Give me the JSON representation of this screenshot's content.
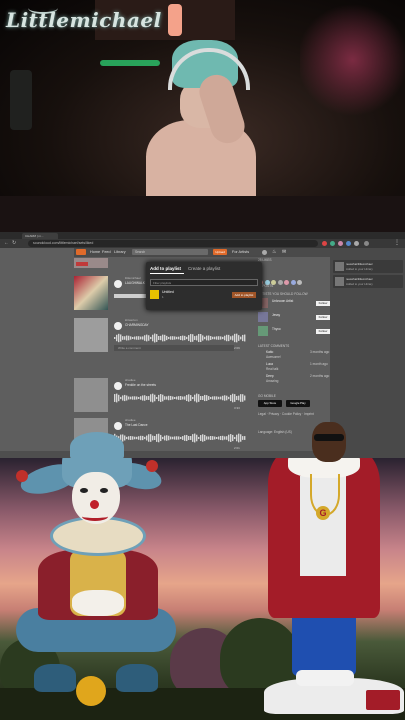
{
  "stream": {
    "logo_text": "Littlemichael"
  },
  "browser": {
    "tab_title": "CHARM | m...",
    "url": "soundcloud.com/littlemichael/sets/liked",
    "nav": {
      "home": "Home",
      "feed": "Feed",
      "library": "Library",
      "search_placeholder": "Search",
      "upload": "Upload",
      "for_artists": "For Artists"
    },
    "tracks": [
      {
        "user": "littlemichael",
        "title": "LAUGHWALK",
        "duration": "3:14"
      },
      {
        "user": "kirtaszion",
        "title": "CHARMINGDAY",
        "duration": "2:09"
      },
      {
        "user": "shadiee",
        "title": "Freddie on the streets",
        "duration": "3:33"
      },
      {
        "user": "shadiee",
        "title": "The Last Dance",
        "duration": "2:01"
      }
    ],
    "track_buttons": [
      "Like",
      "Repost",
      "Share",
      "Copy"
    ],
    "comment_placeholder": "Write a comment",
    "modal": {
      "tab_add": "Add to playlist",
      "tab_create": "Create a playlist",
      "filter_placeholder": "Filter playlists",
      "playlist_name": "Untitled",
      "playlist_count": "1",
      "add_button": "Add to playlist"
    },
    "right": {
      "likes_header": "28 LIKES",
      "reposts_header": "REPOSTS",
      "artists_header": "ARTISTS YOU SHOULD FOLLOW",
      "artists": [
        {
          "name": "Unknown Artist",
          "follow": "Follow"
        },
        {
          "name": "Jessy",
          "follow": "Follow"
        },
        {
          "name": "Thyco",
          "follow": "Follow"
        }
      ],
      "comments_header": "LATEST COMMENTS",
      "comments": [
        {
          "user": "Kaito",
          "text": "Awesome!",
          "time": "3 months ago"
        },
        {
          "user": "Luca",
          "text": "Real talk",
          "time": "1 month ago"
        },
        {
          "user": "Deep",
          "text": "Amazing",
          "time": "2 months ago"
        }
      ],
      "app_header": "GO MOBILE",
      "app_store": "App Store",
      "google_play": "Google Play",
      "footer_text": "Legal · Privacy · Cookie Policy · Imprint",
      "language": "Language: English (US)"
    },
    "notifications": [
      {
        "title": "newwhat/littlemichael",
        "sub": "Added to your Library"
      },
      {
        "title": "newwhat/littlemichael",
        "sub": "Added to your Library"
      }
    ]
  },
  "colors": {
    "soundcloud_orange": "#e06a2a",
    "coat_red": "#a31c28",
    "clown_blue": "#6ea0b8"
  }
}
